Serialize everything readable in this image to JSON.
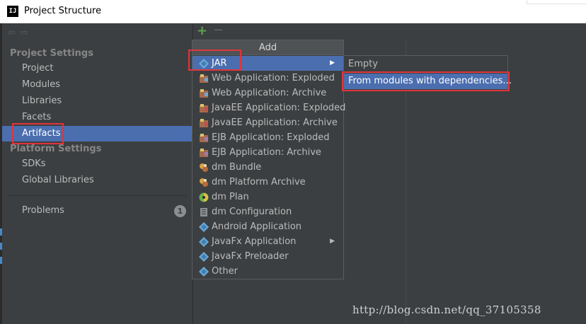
{
  "window": {
    "title": "Project Structure",
    "app_icon": "IJ"
  },
  "sidebar": {
    "nav_back_icon": "back-arrow-icon",
    "nav_forward_icon": "forward-arrow-icon",
    "project_settings_title": "Project Settings",
    "project_settings_items": [
      "Project",
      "Modules",
      "Libraries",
      "Facets",
      "Artifacts"
    ],
    "selected_item": "Artifacts",
    "platform_settings_title": "Platform Settings",
    "platform_settings_items": [
      "SDKs",
      "Global Libraries"
    ],
    "problems_label": "Problems",
    "problems_count": "1"
  },
  "toolbar": {
    "add_symbol": "+",
    "remove_symbol": "−"
  },
  "add_menu": {
    "header": "Add",
    "items": [
      {
        "label": "JAR",
        "icon": "jar-diamond-icon",
        "has_submenu": true
      },
      {
        "label": "Web Application: Exploded",
        "icon": "web-app-icon"
      },
      {
        "label": "Web Application: Archive",
        "icon": "web-app-icon"
      },
      {
        "label": "JavaEE Application: Exploded",
        "icon": "javaee-app-icon"
      },
      {
        "label": "JavaEE Application: Archive",
        "icon": "javaee-app-icon"
      },
      {
        "label": "EJB Application: Exploded",
        "icon": "ejb-app-icon"
      },
      {
        "label": "EJB Application: Archive",
        "icon": "ejb-app-icon"
      },
      {
        "label": "dm Bundle",
        "icon": "dm-bundle-icon"
      },
      {
        "label": "dm Platform Archive",
        "icon": "dm-platform-icon"
      },
      {
        "label": "dm Plan",
        "icon": "dm-plan-icon"
      },
      {
        "label": "dm Configuration",
        "icon": "dm-config-icon"
      },
      {
        "label": "Android Application",
        "icon": "android-diamond-icon"
      },
      {
        "label": "JavaFx Application",
        "icon": "javafx-diamond-icon",
        "has_submenu": true
      },
      {
        "label": "JavaFx Preloader",
        "icon": "javafx-diamond-icon"
      },
      {
        "label": "Other",
        "icon": "other-diamond-icon"
      }
    ]
  },
  "jar_submenu": {
    "items": [
      {
        "label": "Empty"
      },
      {
        "label": "From modules with dependencies..."
      }
    ]
  },
  "colors": {
    "selection": "#4b6eaf",
    "highlight_box": "#e0353a",
    "background": "#3c3f41",
    "add_green": "#5da450"
  },
  "watermark": "http://blog.csdn.net/qq_37105358"
}
